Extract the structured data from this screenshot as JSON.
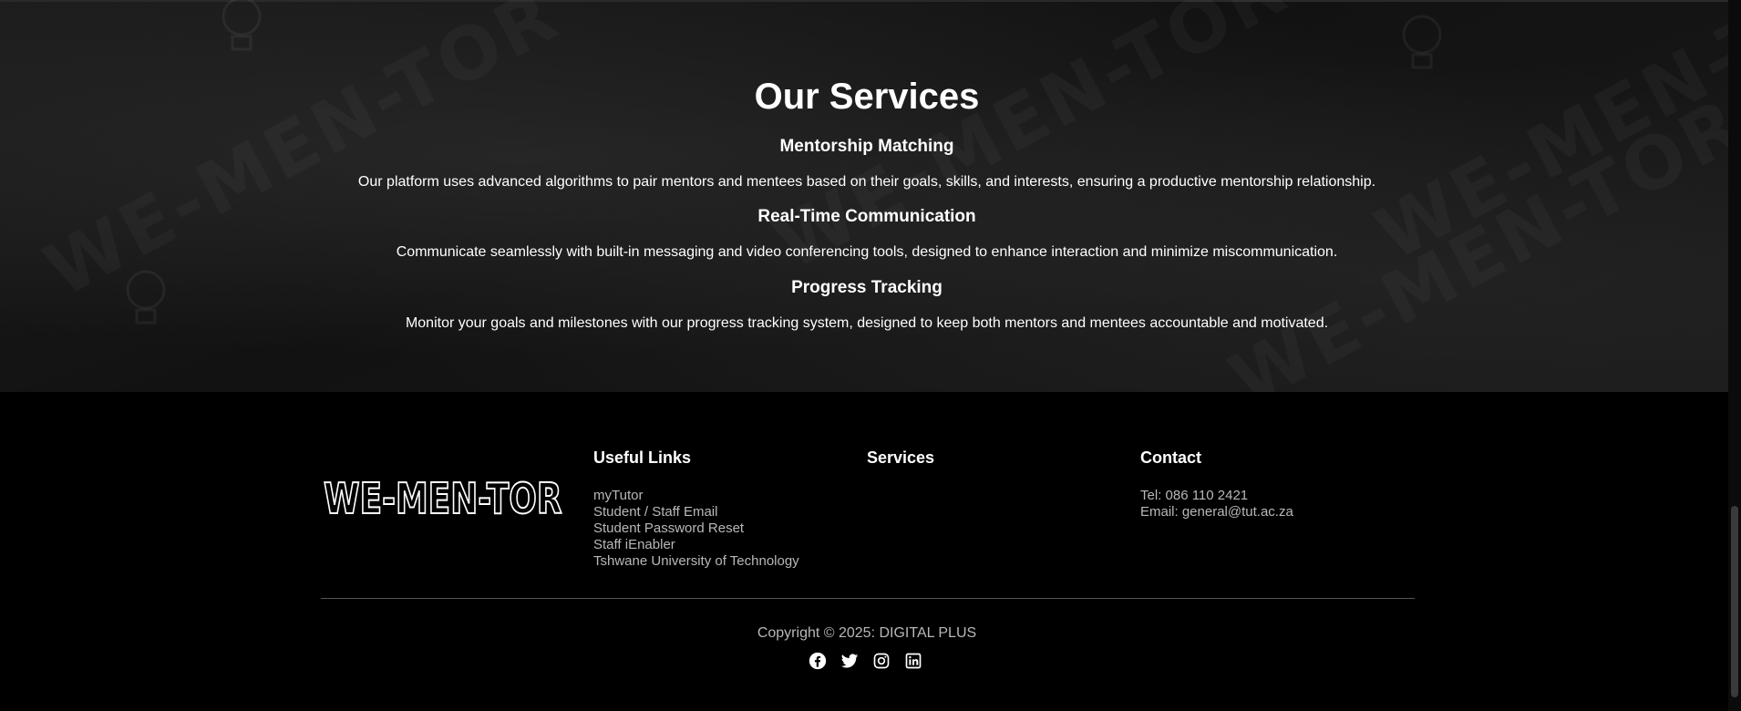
{
  "services": {
    "title": "Our Services",
    "items": [
      {
        "heading": "Mentorship Matching",
        "text": "Our platform uses advanced algorithms to pair mentors and mentees based on their goals, skills, and interests, ensuring a productive mentorship relationship."
      },
      {
        "heading": "Real-Time Communication",
        "text": "Communicate seamlessly with built-in messaging and video conferencing tools, designed to enhance interaction and minimize miscommunication."
      },
      {
        "heading": "Progress Tracking",
        "text": "Monitor your goals and milestones with our progress tracking system, designed to keep both mentors and mentees accountable and motivated."
      }
    ],
    "watermark_text": "WE-MEN-TOR"
  },
  "footer": {
    "logo_text": "WE-MEN-TOR",
    "useful_links": {
      "title": "Useful Links",
      "links": [
        "myTutor",
        "Student / Staff Email",
        "Student Password Reset",
        "Staff iEnabler",
        "Tshwane University of Technology"
      ]
    },
    "services": {
      "title": "Services"
    },
    "contact": {
      "title": "Contact",
      "tel": "Tel: 086 110 2421",
      "email": "Email: general@tut.ac.za"
    },
    "copyright": "Copyright © 2025: DIGITAL PLUS",
    "social_icons": [
      "facebook-icon",
      "twitter-icon",
      "instagram-icon",
      "linkedin-icon"
    ]
  }
}
